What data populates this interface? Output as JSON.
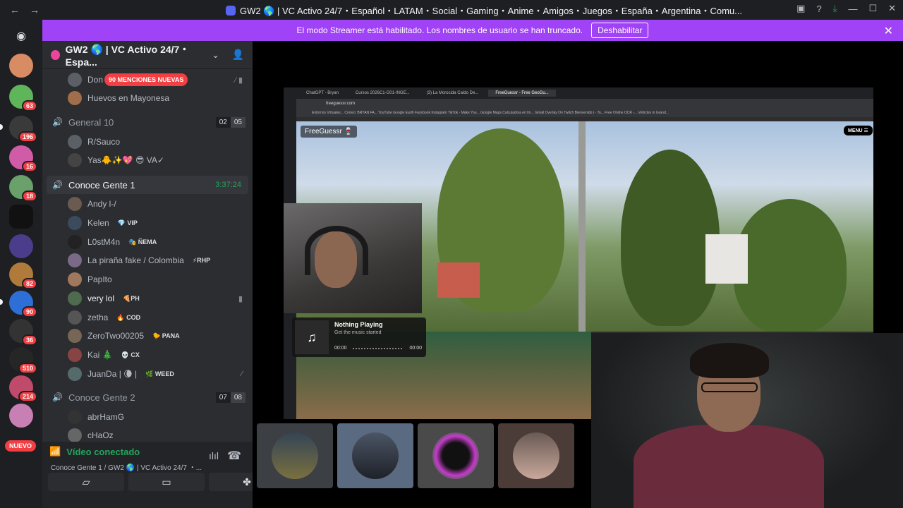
{
  "window": {
    "title": "GW2 🌎 | VC Activo 24/7・Español・LATAM・Social・Gaming・Anime・Amigos・Juegos・España・Argentina・Comu..."
  },
  "banner": {
    "text": "El modo Streamer está habilitado. Los nombres de usuario se han truncado.",
    "button": "Deshabilitar"
  },
  "server_badges": [
    "63",
    "196",
    "16",
    "18",
    "82",
    "90",
    "36",
    "510",
    "214"
  ],
  "nuevo_label": "NUEVO",
  "guild": {
    "name": "GW2 🌎 | VC Activo 24/7・Espa..."
  },
  "mentions_label": "90 MENCIONES NUEVAS",
  "channel_list": {
    "u0": {
      "name": "Don"
    },
    "u1": {
      "name": "Huevos en Mayonesa"
    },
    "vc1": {
      "name": "General 10",
      "limit_a": "02",
      "limit_b": "05"
    },
    "u2": {
      "name": "R/Sauco"
    },
    "u3": {
      "name": "Yas🐥✨💖 😎 VA✓"
    },
    "vc2": {
      "name": "Conoce Gente 1",
      "timer": "3:37:24"
    },
    "u4": {
      "name": "Andy l-/"
    },
    "u5": {
      "name": "Kelen",
      "tag": "💎 VIP"
    },
    "u6": {
      "name": "L0stM4n",
      "tag": "🎭 ÑEMA"
    },
    "u7": {
      "name": "La piraña fake / Colombia",
      "tag": "⚡RHP"
    },
    "u8": {
      "name": "PapIto"
    },
    "u9": {
      "name": "very lol",
      "tag": "🍕PH"
    },
    "u10": {
      "name": "zetha",
      "tag": "🔥 COD"
    },
    "u11": {
      "name": "ZeroTwo00205",
      "tag": "🐤 PANA"
    },
    "u12": {
      "name": "Kai 🎄",
      "tag": "💀 CX"
    },
    "u13": {
      "name": "JuanDa | 🌘 |",
      "tag": "🌿 WEED"
    },
    "vc3": {
      "name": "Conoce Gente 2",
      "limit_a": "07",
      "limit_b": "08"
    },
    "u14": {
      "name": "abrHamG"
    },
    "u15": {
      "name": "cHaOz"
    }
  },
  "voice_panel": {
    "status": "Vídeo conectado",
    "channel": "Conoce Gente 1 / GW2 🌎 | VC Activo 24/7 ・..."
  },
  "browser": {
    "tabs": [
      "ChatGPT - Bryan",
      "Cursos 2026C1-G01-INGE...",
      "(3) La Morocida Caldo De...",
      "FreeGuessr - Free GeoGu..."
    ],
    "url": "freeguessr.com",
    "bookmarks": "Entornos Virtuales...  Correo: BRYAN FA...  YouTube  Google Earth  Facebook  Instagram  TikTok - Make You...  Google Maps  Calculadora en lín...  Gmail  Overlay On  Twitch  Bienvenido | - To...  Free Online OCR -...  Vehicles in Grand..."
  },
  "game": {
    "logo": "FreeGuessr 🍷",
    "menu": "MENU ☰"
  },
  "music_widget": {
    "title": "Nothing Playing",
    "subtitle": "Get the music started",
    "time_start": "00:00",
    "time_end": "00:00"
  },
  "colors": {
    "accent": "#a042f5",
    "voice_green": "#23a55a",
    "badge_red": "#f23f43"
  }
}
